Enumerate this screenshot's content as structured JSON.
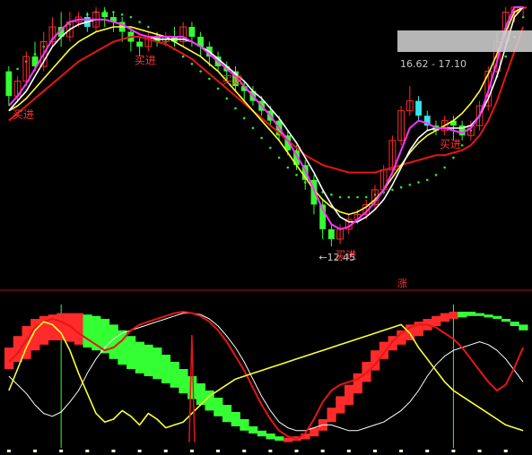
{
  "colors": {
    "background": "#000000",
    "up_candle": "#ff2a2a",
    "down_candle": "#33ff33",
    "cyan_candle": "#33e6e6",
    "ma_white": "#ffffff",
    "ma_magenta": "#ff33ff",
    "ma_yellow": "#ffff33",
    "ma_red": "#e81515",
    "dots_green": "#2ee82e",
    "separator": "#b01010",
    "label_red": "#ff3333",
    "label_gray": "#c8c8c8",
    "green_vline": "#33ff33"
  },
  "top_panel": {
    "buy_labels": [
      "买进",
      "买进",
      "买进",
      "买进",
      "买进"
    ],
    "low_price_label": "12.45",
    "range_label": "16.62 - 17.10"
  },
  "separator_label": "涨",
  "chart_data": [
    {
      "type": "candlestick",
      "panel": "price",
      "title": "",
      "ylim": [
        12.0,
        17.3
      ],
      "candles": [
        [
          16.0,
          15.5,
          16.1,
          15.3
        ],
        [
          15.5,
          15.8,
          15.9,
          15.4
        ],
        [
          15.8,
          16.3,
          16.4,
          15.7
        ],
        [
          16.3,
          16.1,
          16.6,
          16.0
        ],
        [
          16.1,
          16.6,
          16.8,
          16.0
        ],
        [
          16.6,
          16.9,
          17.1,
          16.5
        ],
        [
          16.9,
          16.7,
          17.2,
          16.5
        ],
        [
          16.7,
          17.0,
          17.2,
          16.6
        ],
        [
          17.0,
          17.1,
          17.2,
          16.9
        ],
        [
          17.1,
          16.9,
          17.2,
          16.8
        ],
        [
          16.9,
          17.2,
          17.3,
          16.8
        ],
        [
          17.2,
          17.1,
          17.3,
          16.9
        ],
        [
          17.1,
          17.0,
          17.2,
          16.8
        ],
        [
          17.0,
          16.8,
          17.1,
          16.6
        ],
        [
          16.8,
          16.6,
          16.9,
          16.4
        ],
        [
          16.6,
          16.5,
          16.7,
          16.3
        ],
        [
          16.5,
          16.7,
          16.8,
          16.4
        ],
        [
          16.7,
          16.6,
          16.8,
          16.5
        ],
        [
          16.6,
          16.7,
          16.8,
          16.5
        ],
        [
          16.7,
          16.6,
          16.9,
          16.5
        ],
        [
          16.6,
          16.9,
          17.0,
          16.5
        ],
        [
          16.9,
          16.7,
          17.0,
          16.5
        ],
        [
          16.7,
          16.5,
          16.8,
          16.3
        ],
        [
          16.5,
          16.3,
          16.6,
          16.1
        ],
        [
          16.3,
          16.1,
          16.4,
          16.0
        ],
        [
          16.1,
          16.0,
          16.2,
          15.8
        ],
        [
          16.0,
          15.7,
          16.1,
          15.6
        ],
        [
          15.7,
          15.6,
          15.8,
          15.4
        ],
        [
          15.6,
          15.4,
          15.7,
          15.3
        ],
        [
          15.4,
          15.2,
          15.5,
          15.1
        ],
        [
          15.2,
          15.0,
          15.3,
          14.9
        ],
        [
          15.0,
          14.7,
          15.1,
          14.6
        ],
        [
          14.7,
          14.4,
          14.8,
          14.3
        ],
        [
          14.4,
          14.1,
          14.5,
          14.0
        ],
        [
          14.1,
          13.8,
          14.2,
          13.6
        ],
        [
          13.8,
          13.3,
          13.9,
          13.1
        ],
        [
          13.3,
          12.8,
          13.4,
          12.6
        ],
        [
          12.8,
          12.6,
          12.9,
          12.45
        ],
        [
          12.6,
          12.8,
          12.9,
          12.5
        ],
        [
          12.8,
          13.0,
          13.1,
          12.7
        ],
        [
          13.0,
          13.1,
          13.2,
          12.9
        ],
        [
          13.1,
          13.3,
          13.4,
          13.0
        ],
        [
          13.3,
          13.6,
          13.7,
          13.2
        ],
        [
          13.6,
          14.0,
          14.1,
          13.5
        ],
        [
          14.0,
          14.6,
          14.7,
          13.9
        ],
        [
          14.6,
          15.2,
          15.3,
          14.5
        ],
        [
          15.2,
          15.4,
          15.7,
          15.1
        ],
        [
          15.4,
          15.1,
          15.5,
          15.0
        ],
        [
          15.1,
          14.9,
          15.2,
          14.8
        ],
        [
          14.9,
          14.8,
          15.0,
          14.7
        ],
        [
          14.8,
          15.0,
          15.1,
          14.7
        ],
        [
          15.0,
          14.9,
          15.1,
          14.6
        ],
        [
          14.9,
          14.7,
          15.0,
          14.6
        ],
        [
          14.7,
          14.9,
          15.0,
          14.6
        ],
        [
          14.9,
          15.3,
          15.4,
          14.8
        ],
        [
          15.3,
          16.0,
          16.1,
          15.2
        ],
        [
          16.0,
          16.6,
          16.8,
          15.9
        ],
        [
          16.6,
          17.2,
          17.3,
          16.5
        ],
        [
          17.2,
          17.3,
          17.3,
          17.0
        ],
        [
          17.3,
          17.3,
          17.3,
          17.1
        ]
      ],
      "ma_white": [
        15.2,
        15.4,
        15.6,
        15.9,
        16.2,
        16.5,
        16.7,
        16.85,
        16.95,
        17.0,
        17.05,
        17.05,
        17.0,
        16.95,
        16.85,
        16.75,
        16.7,
        16.65,
        16.65,
        16.65,
        16.65,
        16.6,
        16.5,
        16.4,
        16.25,
        16.1,
        15.95,
        15.8,
        15.6,
        15.45,
        15.25,
        15.05,
        14.8,
        14.55,
        14.25,
        13.95,
        13.6,
        13.3,
        13.05,
        12.95,
        12.95,
        13.05,
        13.2,
        13.4,
        13.7,
        14.05,
        14.4,
        14.65,
        14.8,
        14.85,
        14.85,
        14.85,
        14.85,
        14.9,
        15.1,
        15.45,
        15.9,
        16.5,
        17.1,
        17.3
      ],
      "ma_magenta": [
        15.3,
        15.5,
        15.75,
        16.05,
        16.35,
        16.65,
        16.85,
        17.0,
        17.05,
        17.05,
        17.05,
        17.05,
        17.0,
        16.95,
        16.85,
        16.75,
        16.7,
        16.7,
        16.7,
        16.7,
        16.7,
        16.6,
        16.5,
        16.35,
        16.2,
        16.05,
        15.9,
        15.7,
        15.5,
        15.3,
        15.1,
        14.85,
        14.6,
        14.3,
        14.0,
        13.6,
        13.2,
        12.9,
        12.8,
        12.85,
        13.0,
        13.15,
        13.35,
        13.6,
        13.95,
        14.4,
        14.85,
        15.0,
        14.95,
        14.85,
        14.85,
        14.8,
        14.75,
        14.85,
        15.1,
        15.6,
        16.2,
        16.9,
        17.3,
        17.3
      ],
      "ma_yellow": [
        15.2,
        15.3,
        15.45,
        15.65,
        15.85,
        16.05,
        16.25,
        16.45,
        16.6,
        16.7,
        16.8,
        16.85,
        16.9,
        16.9,
        16.9,
        16.85,
        16.8,
        16.75,
        16.7,
        16.6,
        16.5,
        16.4,
        16.3,
        16.15,
        16.0,
        15.8,
        15.6,
        15.4,
        15.2,
        15.0,
        14.8,
        14.6,
        14.35,
        14.1,
        13.85,
        13.6,
        13.4,
        13.25,
        13.15,
        13.1,
        13.15,
        13.25,
        13.4,
        13.6,
        13.85,
        14.1,
        14.35,
        14.55,
        14.7,
        14.8,
        14.9,
        15.0,
        15.15,
        15.35,
        15.6,
        15.95,
        16.35,
        16.8,
        17.2,
        17.3
      ],
      "ma_red": [
        15.0,
        15.15,
        15.3,
        15.45,
        15.6,
        15.75,
        15.9,
        16.05,
        16.2,
        16.3,
        16.4,
        16.5,
        16.6,
        16.65,
        16.7,
        16.7,
        16.65,
        16.6,
        16.55,
        16.45,
        16.35,
        16.25,
        16.1,
        15.95,
        15.8,
        15.65,
        15.5,
        15.35,
        15.2,
        15.05,
        14.9,
        14.75,
        14.6,
        14.45,
        14.3,
        14.2,
        14.1,
        14.05,
        14.0,
        13.95,
        13.95,
        13.95,
        13.95,
        14.0,
        14.05,
        14.1,
        14.15,
        14.2,
        14.25,
        14.3,
        14.3,
        14.35,
        14.4,
        14.5,
        14.7,
        15.0,
        15.4,
        15.9,
        16.4,
        16.9
      ],
      "dots_green": [
        15.9,
        16.05,
        16.2,
        16.35,
        16.5,
        16.65,
        16.8,
        16.95,
        17.05,
        17.15,
        17.2,
        17.22,
        17.2,
        17.15,
        17.1,
        17.0,
        16.9,
        16.75,
        16.6,
        16.45,
        16.3,
        16.15,
        16.0,
        15.85,
        15.65,
        15.45,
        15.25,
        15.05,
        14.85,
        14.65,
        14.45,
        14.25,
        14.05,
        13.9,
        13.75,
        13.65,
        13.55,
        13.5,
        13.45,
        13.45,
        13.45,
        13.45,
        13.5,
        13.55,
        13.6,
        13.65,
        13.7,
        13.75,
        13.8,
        13.9,
        14.05,
        14.25,
        14.5,
        14.8,
        15.1,
        15.5,
        15.9,
        16.3,
        16.7,
        17.1
      ],
      "buy_signals": [
        0,
        14,
        24,
        37,
        49
      ]
    },
    {
      "type": "area",
      "panel": "indicator",
      "title": "",
      "ylim": [
        0,
        100
      ],
      "band_red": [
        [
          55,
          70
        ],
        [
          60,
          78
        ],
        [
          62,
          85
        ],
        [
          68,
          90
        ],
        [
          72,
          92
        ],
        [
          75,
          93
        ],
        [
          75,
          94
        ],
        [
          74,
          94
        ],
        [
          72,
          94
        ],
        [
          70,
          93
        ],
        [
          68,
          92
        ],
        [
          66,
          90
        ],
        [
          62,
          86
        ],
        [
          58,
          82
        ],
        [
          55,
          78
        ],
        [
          52,
          74
        ],
        [
          50,
          72
        ],
        [
          48,
          70
        ],
        [
          45,
          65
        ],
        [
          42,
          60
        ],
        [
          38,
          55
        ],
        [
          34,
          50
        ],
        [
          30,
          45
        ],
        [
          26,
          40
        ],
        [
          22,
          35
        ],
        [
          18,
          30
        ],
        [
          15,
          25
        ],
        [
          12,
          20
        ],
        [
          10,
          15
        ],
        [
          8,
          12
        ],
        [
          6,
          10
        ],
        [
          5,
          8
        ],
        [
          4,
          7
        ],
        [
          5,
          8
        ],
        [
          6,
          10
        ],
        [
          8,
          14
        ],
        [
          12,
          20
        ],
        [
          18,
          28
        ],
        [
          24,
          36
        ],
        [
          30,
          44
        ],
        [
          38,
          52
        ],
        [
          46,
          60
        ],
        [
          54,
          68
        ],
        [
          62,
          74
        ],
        [
          68,
          78
        ],
        [
          72,
          82
        ],
        [
          75,
          86
        ],
        [
          78,
          88
        ],
        [
          82,
          90
        ],
        [
          85,
          92
        ],
        [
          88,
          94
        ],
        [
          90,
          95
        ],
        [
          91,
          95
        ],
        [
          92,
          95
        ],
        [
          92,
          94
        ],
        [
          91,
          93
        ],
        [
          90,
          92
        ],
        [
          88,
          90
        ],
        [
          85,
          88
        ],
        [
          82,
          86
        ]
      ],
      "band_type": [
        "r",
        "r",
        "r",
        "r",
        "r",
        "r",
        "r",
        "r",
        "r",
        "g",
        "g",
        "g",
        "g",
        "g",
        "g",
        "g",
        "g",
        "g",
        "g",
        "g",
        "g",
        "g",
        "g",
        "g",
        "g",
        "g",
        "g",
        "g",
        "g",
        "g",
        "g",
        "g",
        "r",
        "r",
        "r",
        "r",
        "r",
        "r",
        "r",
        "r",
        "r",
        "r",
        "r",
        "r",
        "r",
        "r",
        "r",
        "r",
        "r",
        "r",
        "r",
        "r",
        "g",
        "g",
        "g",
        "g",
        "g",
        "g",
        "g",
        "g"
      ],
      "line_red": [
        60,
        66,
        75,
        84,
        88,
        90,
        88,
        85,
        80,
        76,
        72,
        68,
        70,
        75,
        82,
        86,
        88,
        90,
        92,
        94,
        95,
        94,
        92,
        88,
        82,
        74,
        64,
        54,
        42,
        30,
        20,
        12,
        8,
        6,
        10,
        20,
        32,
        40,
        44,
        46,
        48,
        52,
        58,
        66,
        74,
        80,
        84,
        86,
        86,
        84,
        80,
        76,
        70,
        62,
        54,
        46,
        40,
        44,
        56,
        70
      ],
      "line_white": [
        50,
        44,
        38,
        30,
        24,
        22,
        25,
        32,
        40,
        52,
        62,
        70,
        76,
        80,
        82,
        84,
        86,
        88,
        90,
        92,
        94,
        94,
        93,
        90,
        85,
        78,
        70,
        60,
        48,
        36,
        26,
        18,
        14,
        12,
        12,
        14,
        16,
        16,
        14,
        12,
        12,
        14,
        16,
        18,
        22,
        26,
        32,
        40,
        50,
        58,
        64,
        68,
        70,
        72,
        74,
        72,
        68,
        62,
        54,
        46
      ],
      "line_yellow": [
        40,
        55,
        70,
        82,
        88,
        86,
        80,
        68,
        52,
        38,
        24,
        18,
        20,
        26,
        22,
        16,
        24,
        20,
        14,
        16,
        18,
        24,
        30,
        36,
        40,
        44,
        48,
        50,
        52,
        54,
        56,
        58,
        60,
        62,
        64,
        66,
        68,
        70,
        72,
        74,
        76,
        78,
        80,
        82,
        84,
        86,
        80,
        70,
        62,
        54,
        46,
        40,
        36,
        32,
        28,
        24,
        20,
        16,
        14,
        12
      ],
      "spike_index": 21,
      "green_vlines": [
        6,
        51
      ]
    }
  ]
}
